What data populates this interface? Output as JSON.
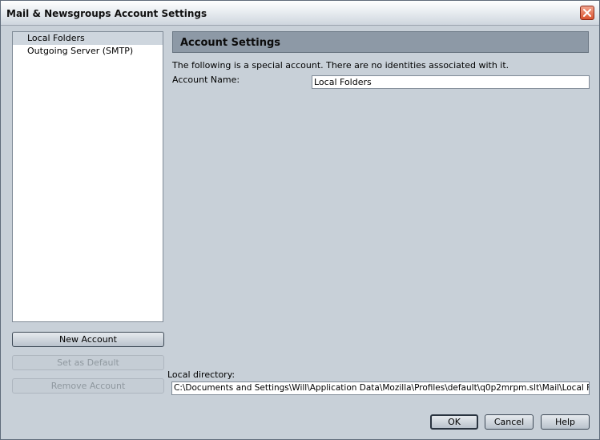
{
  "window": {
    "title": "Mail & Newsgroups Account Settings"
  },
  "accounts": {
    "items": [
      {
        "label": "Local Folders",
        "selected": true
      },
      {
        "label": "Outgoing Server (SMTP)",
        "selected": false
      }
    ]
  },
  "left_buttons": {
    "new_account": "New Account",
    "set_default": "Set as Default",
    "remove_account": "Remove Account"
  },
  "settings": {
    "header": "Account Settings",
    "info": "The following is a special account. There are no identities associated with it.",
    "account_name_label": "Account Name:",
    "account_name_value": "Local Folders",
    "local_directory_label": "Local directory:",
    "local_directory_value": "C:\\Documents and Settings\\Will\\Application Data\\Mozilla\\Profiles\\default\\q0p2mrpm.slt\\Mail\\Local Folders"
  },
  "dialog_buttons": {
    "ok": "OK",
    "cancel": "Cancel",
    "help": "Help"
  },
  "colors": {
    "window_bg": "#c8d0d8",
    "header_bar": "#8d99a6",
    "selected_item": "#ced6de",
    "close_button": "#d9532f"
  }
}
